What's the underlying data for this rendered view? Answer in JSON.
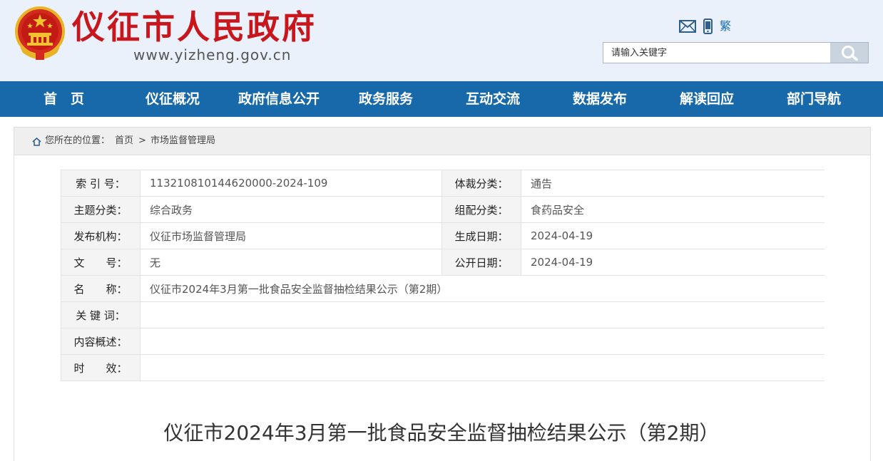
{
  "header": {
    "site_name": "仪征市人民政府",
    "site_url": "www.yizheng.gov.cn",
    "traditional_label": "繁",
    "search_placeholder": "请输入关键字"
  },
  "nav": {
    "items": [
      "首　页",
      "仪征概况",
      "政府信息公开",
      "政务服务",
      "互动交流",
      "数据发布",
      "解读回应",
      "部门导航"
    ]
  },
  "breadcrumb": {
    "prefix": "您所在的位置：",
    "home": "首页",
    "separator": ">",
    "current": "市场监督管理局"
  },
  "info": {
    "index_label": "索 引 号：",
    "index_value": "113210810144620000-2024-109",
    "genre_label": "体裁分类：",
    "genre_value": "通告",
    "topic_label": "主题分类：",
    "topic_value": "综合政务",
    "group_label": "组配分类：",
    "group_value": "食药品安全",
    "publisher_label": "发布机构：",
    "publisher_value": "仪征市场监督管理局",
    "created_label": "生成日期：",
    "created_value": "2024-04-19",
    "docno_label": "文　　号：",
    "docno_value": "无",
    "public_label": "公开日期：",
    "public_value": "2024-04-19",
    "name_label": "名　　称：",
    "name_value": "仪征市2024年3月第一批食品安全监督抽检结果公示（第2期）",
    "keywords_label": "关 键 词：",
    "keywords_value": "",
    "summary_label": "内容概述：",
    "summary_value": "",
    "validity_label": "时　　效：",
    "validity_value": ""
  },
  "article": {
    "title": "仪征市2024年3月第一批食品安全监督抽检结果公示（第2期）"
  },
  "colors": {
    "brand_red": "#c8161d",
    "nav_blue": "#1769aa",
    "header_bg": "#eaf1fa"
  }
}
